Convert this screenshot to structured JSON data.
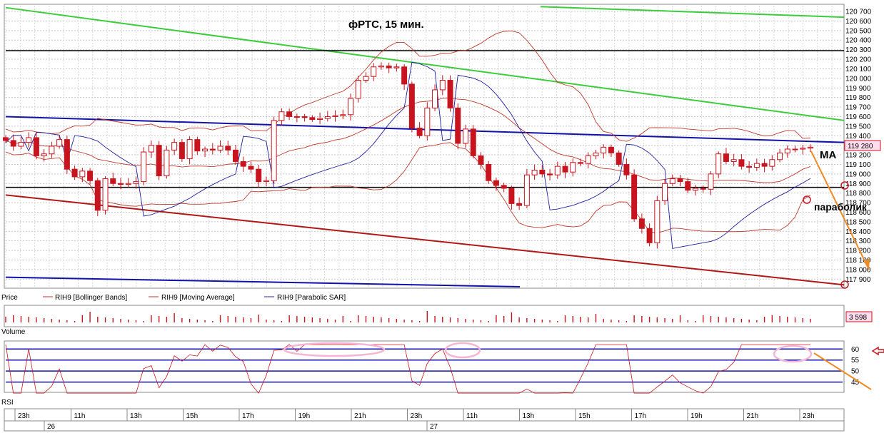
{
  "chart_data": [
    {
      "type": "candlestick",
      "panel": "Price",
      "title": "фРТС,   15 мин.",
      "yticks": [
        117900,
        118000,
        118100,
        118200,
        118300,
        118400,
        118500,
        118600,
        118700,
        118800,
        118900,
        119000,
        119100,
        119200,
        119300,
        119400,
        119500,
        119600,
        119700,
        119800,
        119900,
        120000,
        120100,
        120200,
        120300,
        120400,
        120500,
        120600,
        120700
      ],
      "ytick_labels": [
        "117 900",
        "118 000",
        "118 100",
        "118 200",
        "118 300",
        "118 400",
        "118 500",
        "118 600",
        "118 700",
        "118 800",
        "118 900",
        "119 000",
        "119 100",
        "119 200",
        "119 300",
        "119 400",
        "119 500",
        "119 600",
        "119 700",
        "119 800",
        "119 900",
        "120 000",
        "120 100",
        "120 200",
        "120 300",
        "120 400",
        "120 500",
        "120 600",
        "120 700"
      ],
      "ylim": [
        117820,
        120760
      ],
      "last_price_label": "119 280",
      "close": [
        119350,
        119290,
        119330,
        119380,
        119190,
        119210,
        119290,
        119360,
        119050,
        118970,
        119030,
        118930,
        118620,
        118950,
        118900,
        118890,
        118900,
        118920,
        119230,
        119300,
        118980,
        119250,
        119330,
        119160,
        119360,
        119240,
        119260,
        119250,
        119290,
        119250,
        119130,
        119080,
        119050,
        118920,
        118930,
        119560,
        119650,
        119600,
        119600,
        119590,
        119570,
        119580,
        119600,
        119610,
        119620,
        119790,
        119980,
        120020,
        120120,
        120130,
        120110,
        120120,
        119940,
        119480,
        119400,
        119690,
        119880,
        119980,
        119690,
        119320,
        119470,
        119190,
        119100,
        118930,
        118880,
        118850,
        118690,
        118670,
        118990,
        119040,
        119000,
        118990,
        119080,
        119020,
        119120,
        119110,
        119190,
        119220,
        119280,
        119220,
        119100,
        118990,
        118530,
        118430,
        118280,
        118720,
        118900,
        118950,
        118920,
        118830,
        118850,
        118840,
        119000,
        119210,
        119130,
        119150,
        119080,
        119070,
        119110,
        119080,
        119150,
        119220,
        119260,
        119260,
        119270,
        119280
      ],
      "annotations": [
        "MA",
        "параболик"
      ],
      "rsi_ticks": [
        45,
        50,
        55,
        60
      ],
      "volume_label": "3 598",
      "time_labels": [
        "23h",
        "11h",
        "13h",
        "15h",
        "17h",
        "19h",
        "21h",
        "23h",
        "11h",
        "13h",
        "15h",
        "17h",
        "19h",
        "21h",
        "23h"
      ],
      "day_labels": [
        "26",
        "27"
      ]
    }
  ],
  "legend": [
    {
      "label": "Price"
    },
    {
      "label": "RIH9 [Bollinger Bands]",
      "color": "#cc2a2a"
    },
    {
      "label": "RIH9 [Moving Average]",
      "color": "#cc2a2a"
    },
    {
      "label": "RIH9 [Parabolic SAR]",
      "color": "#2a2aa8"
    }
  ],
  "panel_labels": {
    "volume": "Volume",
    "rsi": "RSI"
  },
  "colors": {
    "candle": "#c8141e",
    "bands": "#c0392b",
    "sar": "#1f1fa0",
    "trend_green": "#3ccc3c",
    "trend_blue": "#1212a8",
    "trend_red": "#b01818",
    "level": "#000000",
    "ellipse": "#f5b6d6",
    "forecast": "#f08a24"
  }
}
